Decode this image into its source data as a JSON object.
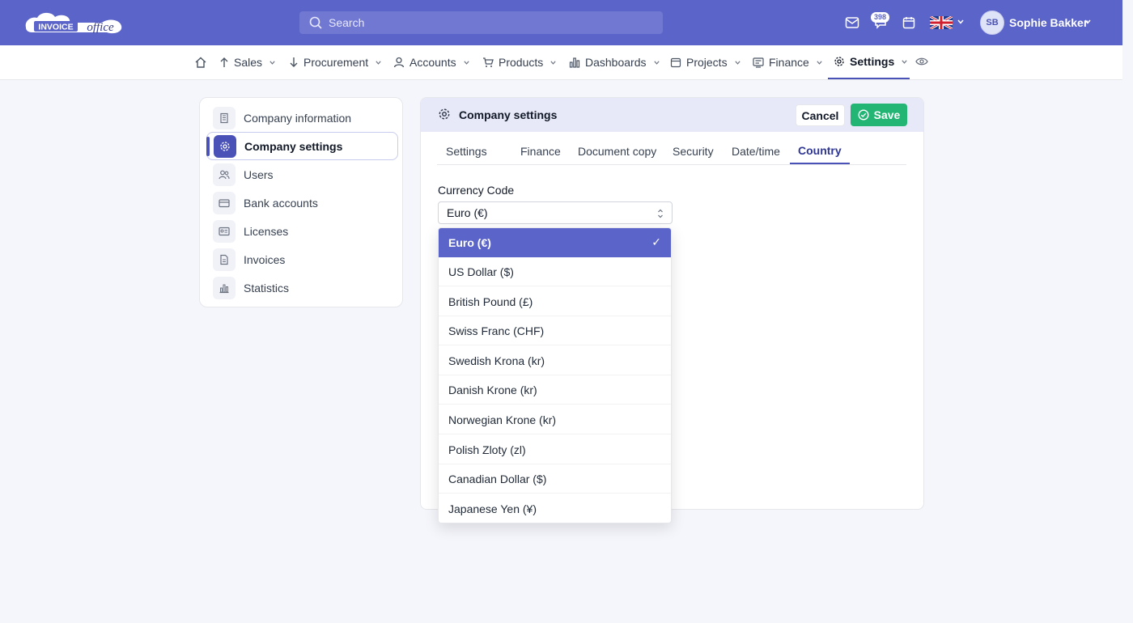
{
  "header": {
    "logo_text": "INVOICE office",
    "search_placeholder": "Search",
    "notification_count": "398",
    "user_initials": "SB",
    "user_name": "Sophie Bakker"
  },
  "nav": {
    "items": [
      {
        "label": "Sales",
        "icon": "arrow-up-icon"
      },
      {
        "label": "Procurement",
        "icon": "arrow-down-icon"
      },
      {
        "label": "Accounts",
        "icon": "person-icon"
      },
      {
        "label": "Products",
        "icon": "cart-icon"
      },
      {
        "label": "Dashboards",
        "icon": "bar-chart-icon"
      },
      {
        "label": "Projects",
        "icon": "calendar-icon"
      },
      {
        "label": "Finance",
        "icon": "finance-icon"
      },
      {
        "label": "Settings",
        "icon": "gear-icon"
      }
    ],
    "active": "Settings"
  },
  "sidebar": {
    "items": [
      {
        "label": "Company information",
        "icon": "building-icon"
      },
      {
        "label": "Company settings",
        "icon": "gear-icon"
      },
      {
        "label": "Users",
        "icon": "users-icon"
      },
      {
        "label": "Bank accounts",
        "icon": "card-icon"
      },
      {
        "label": "Licenses",
        "icon": "license-icon"
      },
      {
        "label": "Invoices",
        "icon": "document-icon"
      },
      {
        "label": "Statistics",
        "icon": "chart-icon"
      }
    ],
    "active": "Company settings"
  },
  "panel": {
    "title": "Company settings",
    "cancel_label": "Cancel",
    "save_label": "Save",
    "tabs": [
      "Settings",
      "Finance",
      "Document copy",
      "Security",
      "Date/time",
      "Country"
    ],
    "active_tab": "Country",
    "field_label": "Currency Code",
    "field_value": "Euro (€)"
  },
  "dropdown": {
    "options": [
      "Euro (€)",
      "US Dollar ($)",
      "British Pound (£)",
      "Swiss Franc (CHF)",
      "Swedish Krona (kr)",
      "Danish Krone (kr)",
      "Norwegian Krone (kr)",
      "Polish Zloty (zl)",
      "Canadian Dollar ($)",
      "Japanese Yen (¥)"
    ],
    "selected": "Euro (€)",
    "check_mark": "✓"
  },
  "colors": {
    "brand": "#5b64c9",
    "accent_dark": "#4a52b7",
    "save_green": "#22b573",
    "panel_header": "#e7e9f8"
  }
}
